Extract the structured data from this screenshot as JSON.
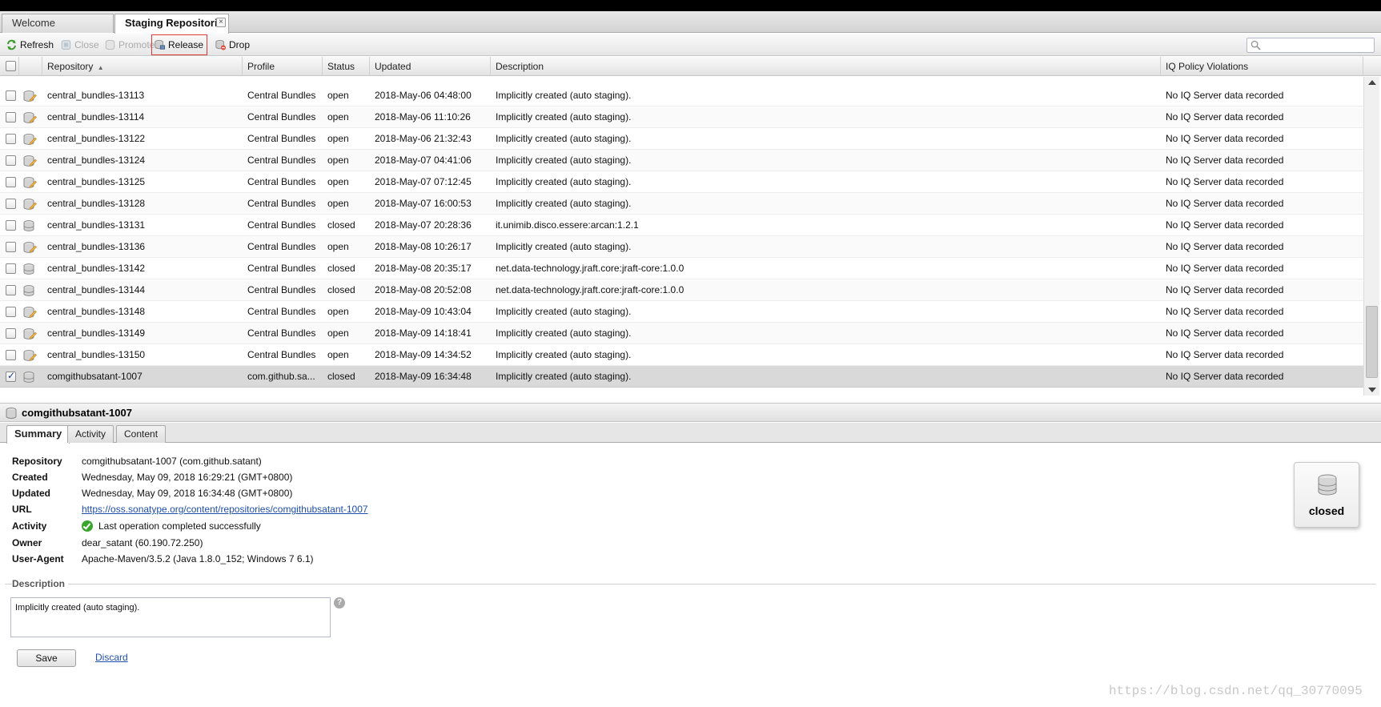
{
  "tabs": [
    {
      "label": "Welcome",
      "active": false
    },
    {
      "label": "Staging Repositori",
      "active": true,
      "close_label": "×"
    }
  ],
  "toolbar": {
    "refresh": "Refresh",
    "close": "Close",
    "promote": "Promote",
    "release": "Release",
    "drop": "Drop",
    "search_placeholder": ""
  },
  "grid": {
    "columns": [
      "Repository",
      "Profile",
      "Status",
      "Updated",
      "Description",
      "IQ Policy Violations"
    ],
    "sort_indicator": "▲",
    "rows": [
      {
        "repository": "central_bundles-13113",
        "profile": "Central Bundles",
        "status": "open",
        "updated": "2018-May-06 04:48:00",
        "description": "Implicitly created (auto staging).",
        "iq": "No IQ Server data recorded",
        "checked": false
      },
      {
        "repository": "central_bundles-13114",
        "profile": "Central Bundles",
        "status": "open",
        "updated": "2018-May-06 11:10:26",
        "description": "Implicitly created (auto staging).",
        "iq": "No IQ Server data recorded",
        "checked": false
      },
      {
        "repository": "central_bundles-13122",
        "profile": "Central Bundles",
        "status": "open",
        "updated": "2018-May-06 21:32:43",
        "description": "Implicitly created (auto staging).",
        "iq": "No IQ Server data recorded",
        "checked": false
      },
      {
        "repository": "central_bundles-13124",
        "profile": "Central Bundles",
        "status": "open",
        "updated": "2018-May-07 04:41:06",
        "description": "Implicitly created (auto staging).",
        "iq": "No IQ Server data recorded",
        "checked": false
      },
      {
        "repository": "central_bundles-13125",
        "profile": "Central Bundles",
        "status": "open",
        "updated": "2018-May-07 07:12:45",
        "description": "Implicitly created (auto staging).",
        "iq": "No IQ Server data recorded",
        "checked": false
      },
      {
        "repository": "central_bundles-13128",
        "profile": "Central Bundles",
        "status": "open",
        "updated": "2018-May-07 16:00:53",
        "description": "Implicitly created (auto staging).",
        "iq": "No IQ Server data recorded",
        "checked": false
      },
      {
        "repository": "central_bundles-13131",
        "profile": "Central Bundles",
        "status": "closed",
        "updated": "2018-May-07 20:28:36",
        "description": "it.unimib.disco.essere:arcan:1.2.1",
        "iq": "No IQ Server data recorded",
        "checked": false
      },
      {
        "repository": "central_bundles-13136",
        "profile": "Central Bundles",
        "status": "open",
        "updated": "2018-May-08 10:26:17",
        "description": "Implicitly created (auto staging).",
        "iq": "No IQ Server data recorded",
        "checked": false
      },
      {
        "repository": "central_bundles-13142",
        "profile": "Central Bundles",
        "status": "closed",
        "updated": "2018-May-08 20:35:17",
        "description": "net.data-technology.jraft.core:jraft-core:1.0.0",
        "iq": "No IQ Server data recorded",
        "checked": false
      },
      {
        "repository": "central_bundles-13144",
        "profile": "Central Bundles",
        "status": "closed",
        "updated": "2018-May-08 20:52:08",
        "description": "net.data-technology.jraft.core:jraft-core:1.0.0",
        "iq": "No IQ Server data recorded",
        "checked": false
      },
      {
        "repository": "central_bundles-13148",
        "profile": "Central Bundles",
        "status": "open",
        "updated": "2018-May-09 10:43:04",
        "description": "Implicitly created (auto staging).",
        "iq": "No IQ Server data recorded",
        "checked": false
      },
      {
        "repository": "central_bundles-13149",
        "profile": "Central Bundles",
        "status": "open",
        "updated": "2018-May-09 14:18:41",
        "description": "Implicitly created (auto staging).",
        "iq": "No IQ Server data recorded",
        "checked": false
      },
      {
        "repository": "central_bundles-13150",
        "profile": "Central Bundles",
        "status": "open",
        "updated": "2018-May-09 14:34:52",
        "description": "Implicitly created (auto staging).",
        "iq": "No IQ Server data recorded",
        "checked": false
      },
      {
        "repository": "comgithubsatant-1007",
        "profile": "com.github.sa...",
        "status": "closed",
        "updated": "2018-May-09 16:34:48",
        "description": "Implicitly created (auto staging).",
        "iq": "No IQ Server data recorded",
        "checked": true
      }
    ]
  },
  "detail": {
    "title": "comgithubsatant-1007",
    "tabs": [
      "Summary",
      "Activity",
      "Content"
    ],
    "fields": [
      {
        "label": "Repository",
        "value": "comgithubsatant-1007 (com.github.satant)"
      },
      {
        "label": "Created",
        "value": "Wednesday, May 09, 2018 16:29:21 (GMT+0800)"
      },
      {
        "label": "Updated",
        "value": "Wednesday, May 09, 2018 16:34:48 (GMT+0800)"
      },
      {
        "label": "URL",
        "value": "https://oss.sonatype.org/content/repositories/comgithubsatant-1007"
      },
      {
        "label": "Activity",
        "value": "Last operation completed successfully"
      },
      {
        "label": "Owner",
        "value": "dear_satant (60.190.72.250)"
      },
      {
        "label": "User-Agent",
        "value": "Apache-Maven/3.5.2 (Java 1.8.0_152; Windows 7 6.1)"
      }
    ],
    "status_card": "closed",
    "description_legend": "Description",
    "description_value": "Implicitly created (auto staging).",
    "help": "?",
    "save": "Save",
    "discard": "Discard"
  },
  "watermark": "https://blog.csdn.net/qq_30770095",
  "colors": {
    "selected_row": "#d9d9d9",
    "link": "#1f4ea8",
    "release_outline": "#e23a3a",
    "ok_green": "#3aa52c"
  }
}
